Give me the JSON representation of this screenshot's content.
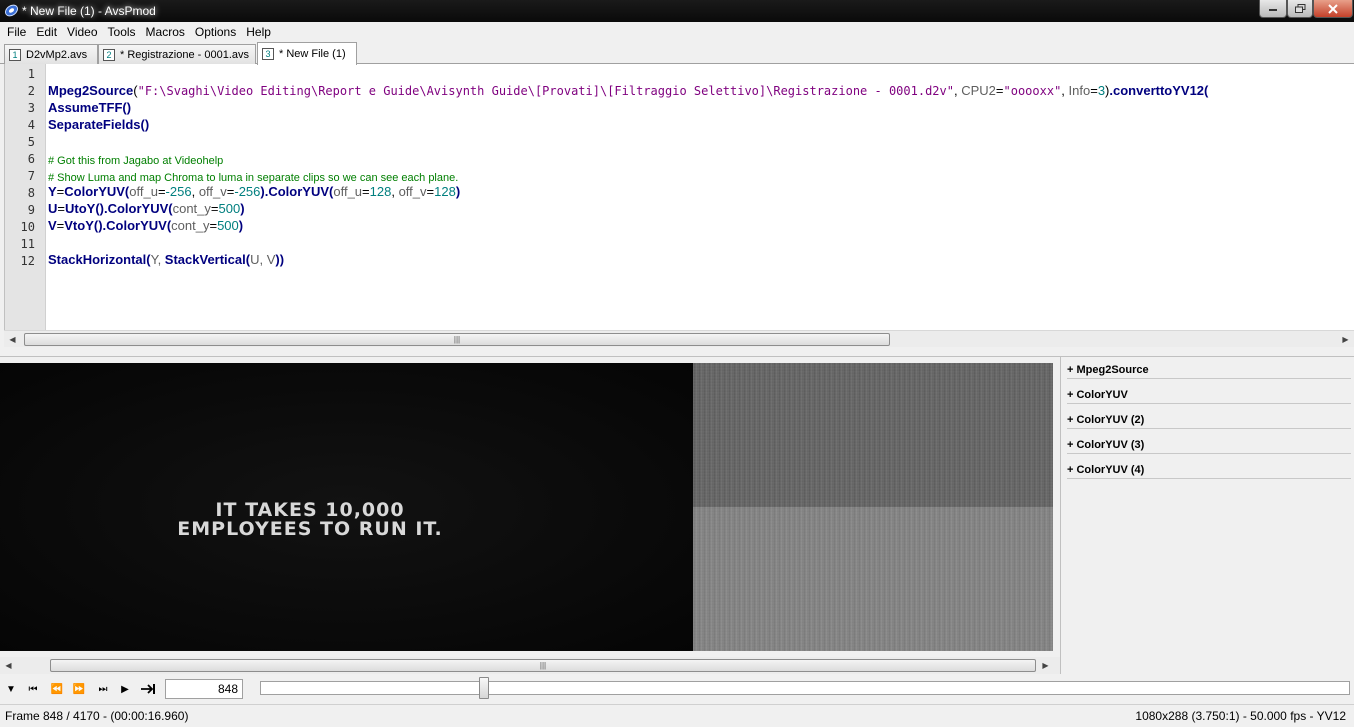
{
  "window": {
    "title": "* New File (1) - AvsPmod"
  },
  "menu": [
    "File",
    "Edit",
    "Video",
    "Tools",
    "Macros",
    "Options",
    "Help"
  ],
  "tabs": [
    {
      "num": "1",
      "label": "D2vMp2.avs",
      "active": false
    },
    {
      "num": "2",
      "label": "* Registrazione - 0001.avs",
      "active": false
    },
    {
      "num": "3",
      "label": "* New File (1)",
      "active": true
    }
  ],
  "editor": {
    "line_numbers": [
      "1",
      "2",
      "3",
      "4",
      "5",
      "6",
      "7",
      "8",
      "9",
      "10",
      "11",
      "12"
    ],
    "lines": {
      "l2_fn": "Mpeg2Source",
      "l2_str": "\"F:\\Svaghi\\Video Editing\\Report e Guide\\Avisynth Guide\\[Provati]\\[Filtraggio Selettivo]\\Registrazione - 0001.d2v\"",
      "l2_arg1": "CPU2",
      "l2_val1": "\"ooooxx\"",
      "l2_arg2": "Info",
      "l2_val2": "3",
      "l2_fn2": ".converttoYV12(",
      "l3": "AssumeTFF()",
      "l4": "SeparateFields()",
      "l6": "# Got this from Jagabo at Videohelp",
      "l7": "# Show Luma and map Chroma to luma in separate clips so we can see each plane.",
      "l8_var": "Y",
      "l8_fn1": "ColorYUV(",
      "l8_a1": "off_u",
      "l8_v1": "-256",
      "l8_a2": "off_v",
      "l8_v2": "-256",
      "l8_fn2": ").ColorYUV(",
      "l8_a3": "off_u",
      "l8_v3": "128",
      "l8_a4": "off_v",
      "l8_v4": "128",
      "l9_var": "U",
      "l9_fn": "UtoY().ColorYUV(",
      "l9_a": "cont_y",
      "l9_v": "500",
      "l10_var": "V",
      "l10_fn": "VtoY().ColorYUV(",
      "l10_a": "cont_y",
      "l10_v": "500",
      "l12_fn1": "StackHorizontal(",
      "l12_a1": "Y, ",
      "l12_fn2": "StackVertical(",
      "l12_a2": "U, V",
      "l12_end": "))"
    }
  },
  "video": {
    "subtitle_line1": "IT TAKES 10,000",
    "subtitle_line2": "EMPLOYEES TO RUN IT."
  },
  "filters": [
    "+ Mpeg2Source",
    "+ ColorYUV",
    "+ ColorYUV (2)",
    "+ ColorYUV (3)",
    "+ ColorYUV (4)"
  ],
  "transport": {
    "frame_value": "848",
    "position_fraction": 0.203
  },
  "status": {
    "left": "Frame 848 / 4170  -  (00:00:16.960)",
    "right": "1080x288 (3.750:1)  -  50.000 fps  -  YV12"
  },
  "icons": {
    "app": "avspmod-app-icon",
    "minimize": "minimize-icon",
    "maximize": "maximize-icon",
    "close": "close-icon"
  }
}
